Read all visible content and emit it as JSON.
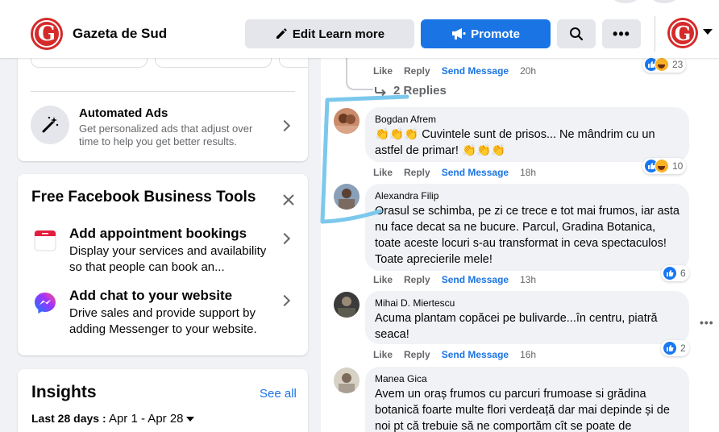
{
  "header": {
    "page_name": "Gazeta de Sud",
    "logo_letter": "G",
    "edit_label": "Edit Learn more",
    "promote_label": "Promote",
    "search_icon": "search-icon",
    "more_label": "•••"
  },
  "automated_ads": {
    "title": "Automated Ads",
    "description": "Get personalized ads that adjust over time to help you get better results."
  },
  "tools": {
    "title": "Free Facebook Business Tools",
    "items": [
      {
        "title": "Add appointment bookings",
        "description": "Display your services and availability so that people can book an...",
        "icon": "calendar-icon"
      },
      {
        "title": "Add chat to your website",
        "description": "Drive sales and provide support by adding Messenger to your website.",
        "icon": "messenger-icon"
      }
    ]
  },
  "insights": {
    "title": "Insights",
    "see_all": "See all",
    "period_label": "Last 28 days :",
    "period_range": "Apr 1 - Apr 28"
  },
  "comments": {
    "like_label": "Like",
    "reply_label": "Reply",
    "send_label": "Send Message",
    "top_time": "20h",
    "top_reactions": "23",
    "replies_label": "2 Replies",
    "items": [
      {
        "name": "Bogdan Afrem",
        "text_line1": "👏👏👏 Cuvintele sunt de prisos... Ne mândrim cu un",
        "text_line2": "astfel de primar! 👏👏👏",
        "time": "18h",
        "reactions": "10"
      },
      {
        "name": "Alexandra Filip",
        "text": "Orasul se schimba, pe zi ce trece e tot mai frumos, iar asta nu face decat sa ne bucure. Parcul, Gradina Botanica, toate aceste locuri s-au transformat in ceva spectaculos! Toate aprecierile mele!",
        "time": "13h",
        "reactions": "6"
      },
      {
        "name": "Mihai D. Miertescu",
        "text": "Acuma plantam copăcei pe bulivarde...în centru, piatră seaca!",
        "time": "16h",
        "reactions": "2"
      },
      {
        "name": "Manea Gica",
        "text": "Avem un oraș frumos cu parcuri frumoase si grădina botanică foarte multe flori verdeață dar mai depinde și de noi pt că trebuie să ne comportăm cît se poate de"
      }
    ]
  },
  "colors": {
    "brand_red": "#d42a2a",
    "accent_blue": "#1b74e4",
    "annotation_blue": "#7cc8ec"
  }
}
